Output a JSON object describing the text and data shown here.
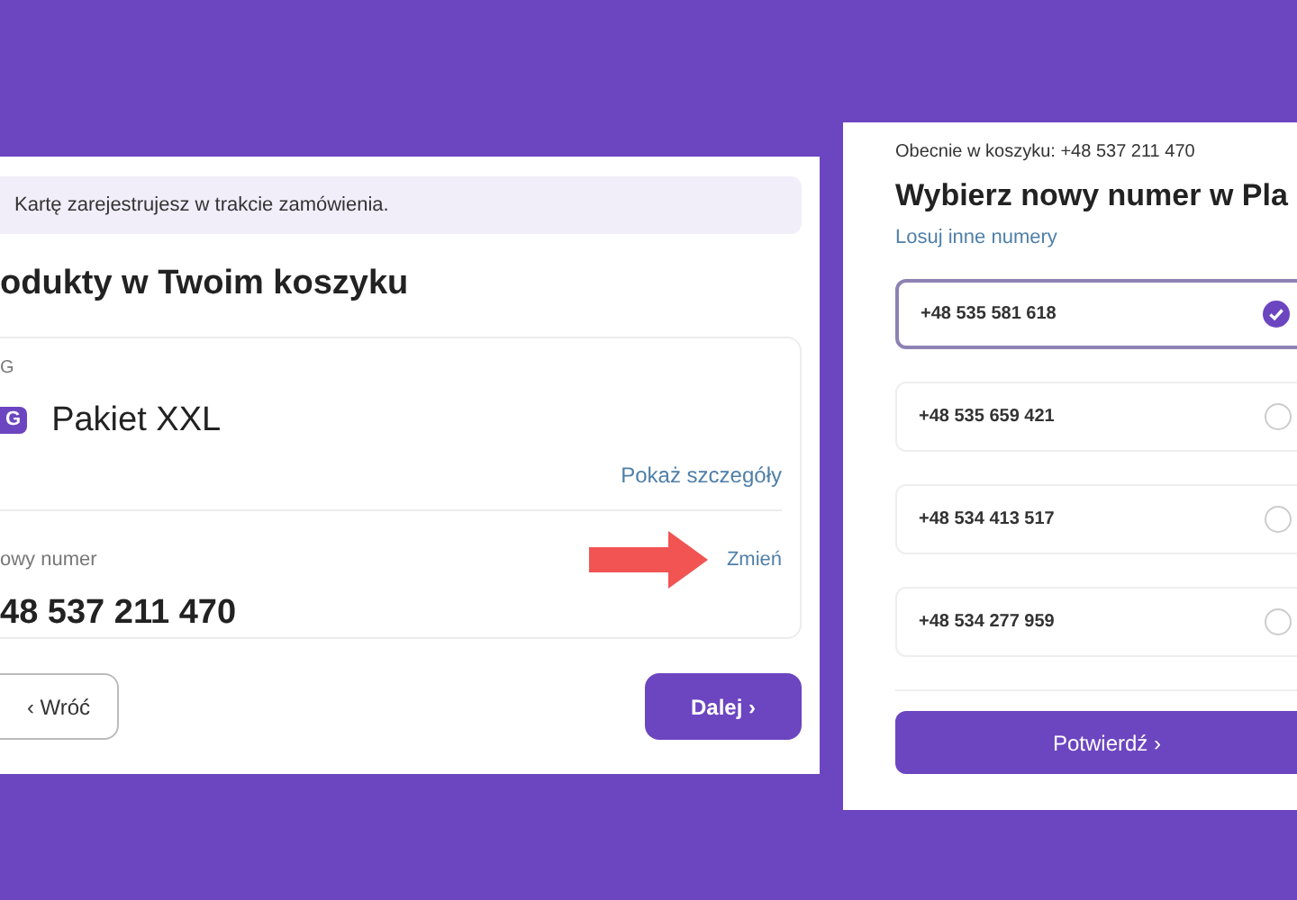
{
  "cart_panel": {
    "notice": "Kartę zarejestrujesz w trakcie zamówienia.",
    "title": "odukty w Twoim koszyku",
    "category": "G",
    "badge": "G",
    "product": "Pakiet XXL",
    "details_link": "Pokaż szczegóły",
    "number_label": "owy numer",
    "number": "48 537 211 470",
    "change_link": "Zmień",
    "back_button": "‹ Wróć",
    "next_button": "Dalej ›"
  },
  "picker_panel": {
    "current": "Obecnie w koszyku: +48 537 211 470",
    "title": "Wybierz nowy numer w Pla",
    "shuffle_link": "Losuj inne numery",
    "numbers": [
      {
        "number": "+48 535 581 618",
        "selected": true
      },
      {
        "number": "+48 535 659 421",
        "selected": false
      },
      {
        "number": "+48 534 413 517",
        "selected": false
      },
      {
        "number": "+48 534 277 959",
        "selected": false
      }
    ],
    "confirm_button": "Potwierdź ›"
  }
}
